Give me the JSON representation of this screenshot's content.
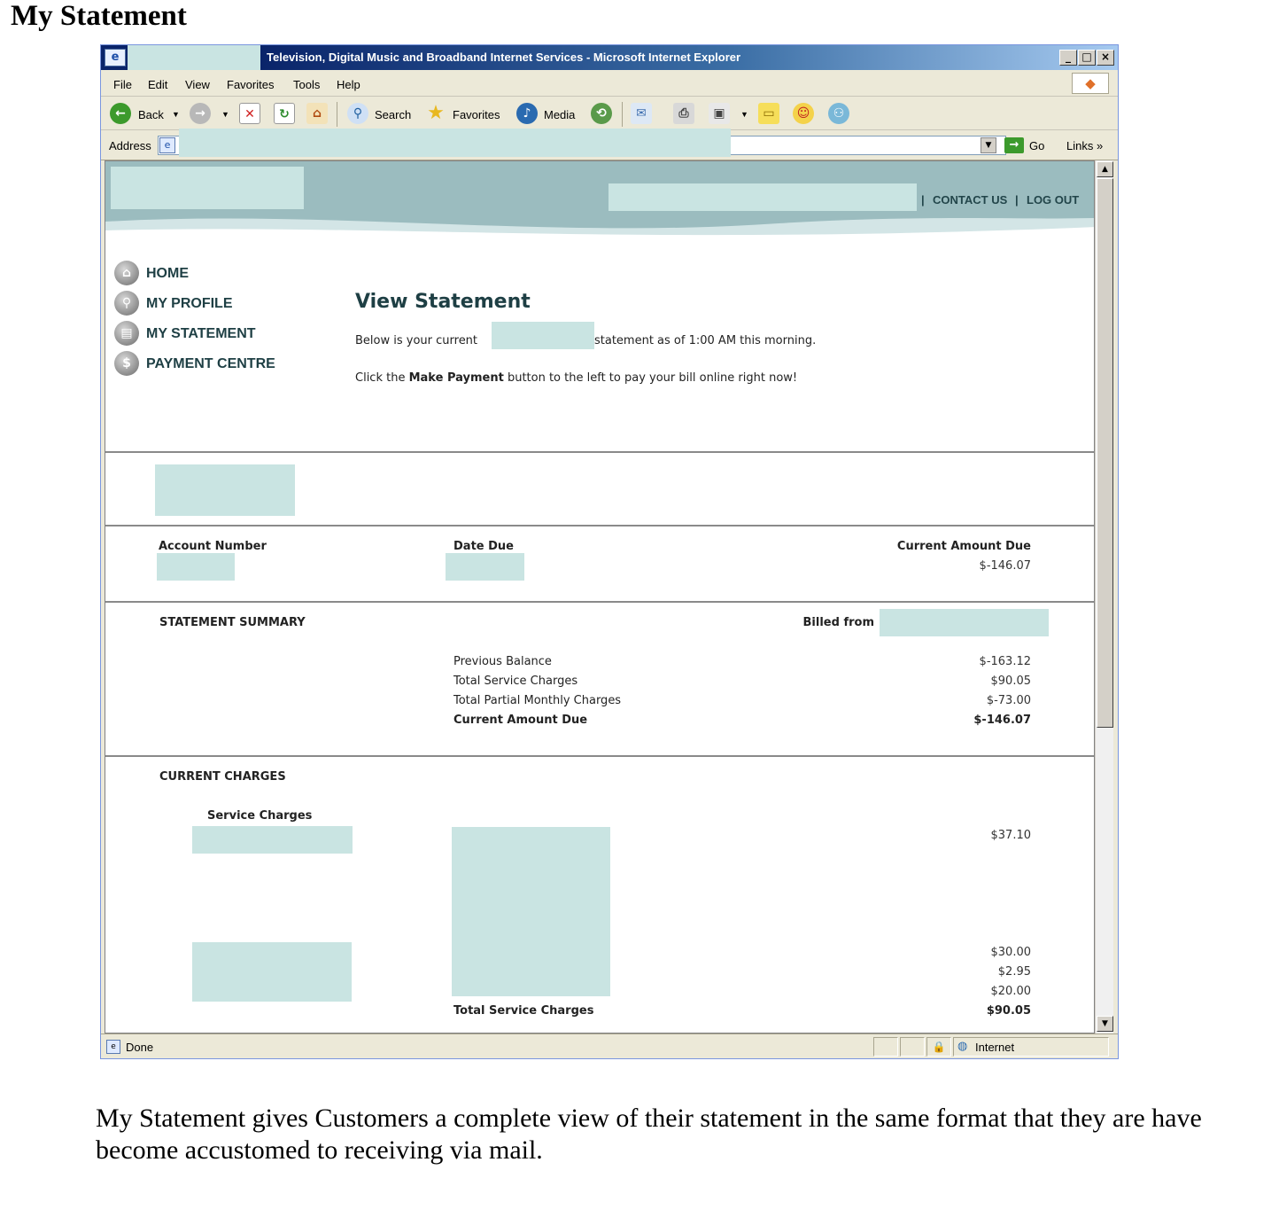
{
  "document": {
    "title": "My Statement",
    "caption": "My Statement gives Customers a complete view of their statement in the same format that they are have become accustomed to receiving via mail."
  },
  "browser": {
    "window_title": "Television, Digital Music and Broadband Internet Services - Microsoft Internet Explorer",
    "menu": [
      "File",
      "Edit",
      "View",
      "Favorites",
      "Tools",
      "Help"
    ],
    "toolbar": {
      "back": "Back",
      "search": "Search",
      "favorites": "Favorites",
      "media": "Media"
    },
    "address_label": "Address",
    "go_label": "Go",
    "links_label": "Links",
    "status_text": "Done",
    "zone": "Internet"
  },
  "site": {
    "nav": {
      "contact": "CONTACT US",
      "logout": "LOG OUT",
      "separator": "|"
    },
    "sidebar": [
      {
        "label": "HOME",
        "icon": "home-icon",
        "glyph": "⌂"
      },
      {
        "label": "MY PROFILE",
        "icon": "profile-icon",
        "glyph": "👤"
      },
      {
        "label": "MY STATEMENT",
        "icon": "statement-icon",
        "glyph": "▤"
      },
      {
        "label": "PAYMENT CENTRE",
        "icon": "payment-icon",
        "glyph": "$"
      }
    ],
    "heading": "View Statement",
    "intro_before": "Below is your current",
    "intro_after": "statement as of 1:00 AM this morning.",
    "pay_before": "Click the",
    "pay_bold": "Make Payment",
    "pay_after": "button to the left to pay your bill online right now!"
  },
  "statement": {
    "account_label": "Account Number",
    "date_due_label": "Date Due",
    "amount_due_label": "Current Amount Due",
    "amount_due": "$-146.07",
    "summary_title": "STATEMENT SUMMARY",
    "billed_from_label": "Billed from",
    "summary_rows": [
      {
        "label": "Previous Balance",
        "value": "$-163.12"
      },
      {
        "label": "Total Service Charges",
        "value": "$90.05"
      },
      {
        "label": "Total Partial Monthly Charges",
        "value": "$-73.00"
      },
      {
        "label": "Current Amount Due",
        "value": "$-146.07"
      }
    ],
    "charges_title": "CURRENT CHARGES",
    "service_charges_label": "Service Charges",
    "charge_values": [
      "$37.10",
      "$30.00",
      "$2.95",
      "$20.00"
    ],
    "total_label": "Total Service Charges",
    "total_value": "$90.05"
  }
}
